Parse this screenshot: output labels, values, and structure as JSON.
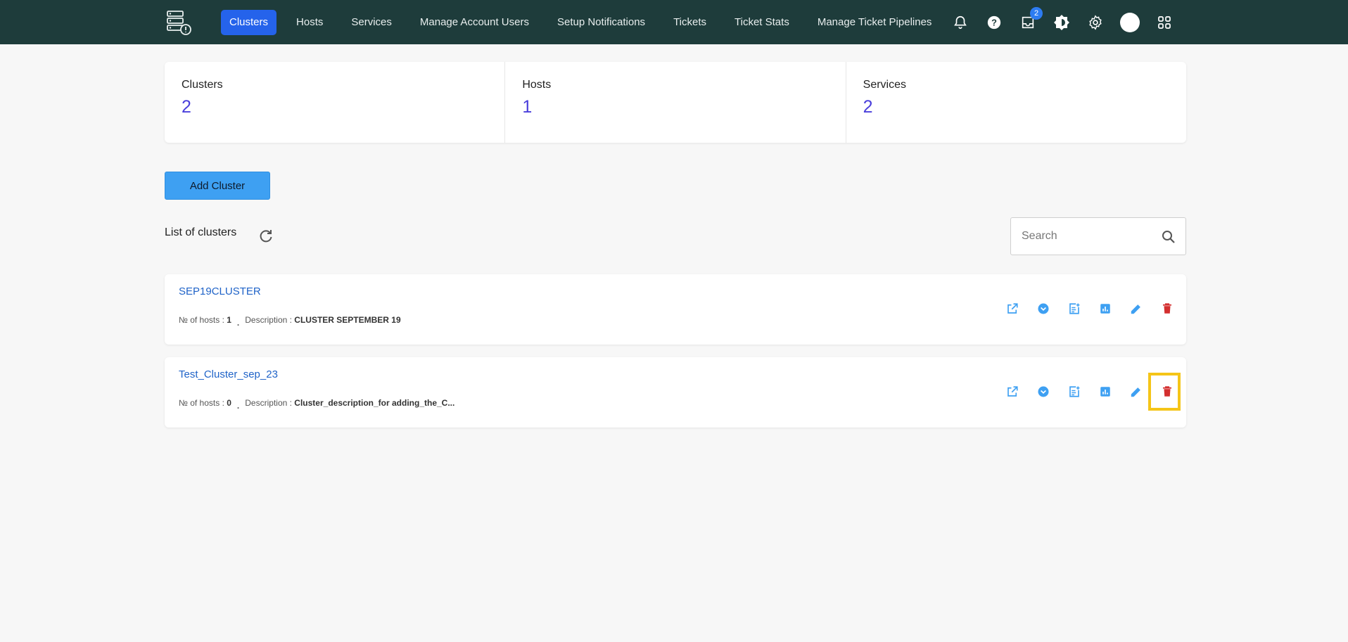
{
  "nav": {
    "items": [
      {
        "label": "Clusters",
        "active": true
      },
      {
        "label": "Hosts"
      },
      {
        "label": "Services"
      },
      {
        "label": "Manage Account Users"
      },
      {
        "label": "Setup Notifications"
      },
      {
        "label": "Tickets"
      },
      {
        "label": "Ticket Stats"
      },
      {
        "label": "Manage Ticket Pipelines"
      }
    ],
    "inbox_badge": "2",
    "icons": [
      "bell-icon",
      "help-icon",
      "inbox-icon",
      "brightness-icon",
      "gear-icon",
      "avatar",
      "apps-icon"
    ]
  },
  "stats": [
    {
      "label": "Clusters",
      "value": "2"
    },
    {
      "label": "Hosts",
      "value": "1"
    },
    {
      "label": "Services",
      "value": "2"
    }
  ],
  "add_cluster_label": "Add Cluster",
  "list_title": "List of clusters",
  "search": {
    "placeholder": "Search"
  },
  "clusters": [
    {
      "name": "SEP19CLUSTER",
      "hosts_label": "№ of hosts : ",
      "hosts": "1",
      "separator": ".",
      "desc_label": "Description : ",
      "description": "CLUSTER SEPTEMBER 19"
    },
    {
      "name": "Test_Cluster_sep_23",
      "hosts_label": "№ of hosts : ",
      "hosts": "0",
      "separator": ".",
      "desc_label": "Description : ",
      "description": "Cluster_description_for adding_the_C..."
    }
  ],
  "colors": {
    "topbar": "#1e3c3b",
    "accent": "#2563eb",
    "icon_blue": "#3ea0f2",
    "delete_red": "#d32f2f",
    "highlight": "#f5c518"
  }
}
